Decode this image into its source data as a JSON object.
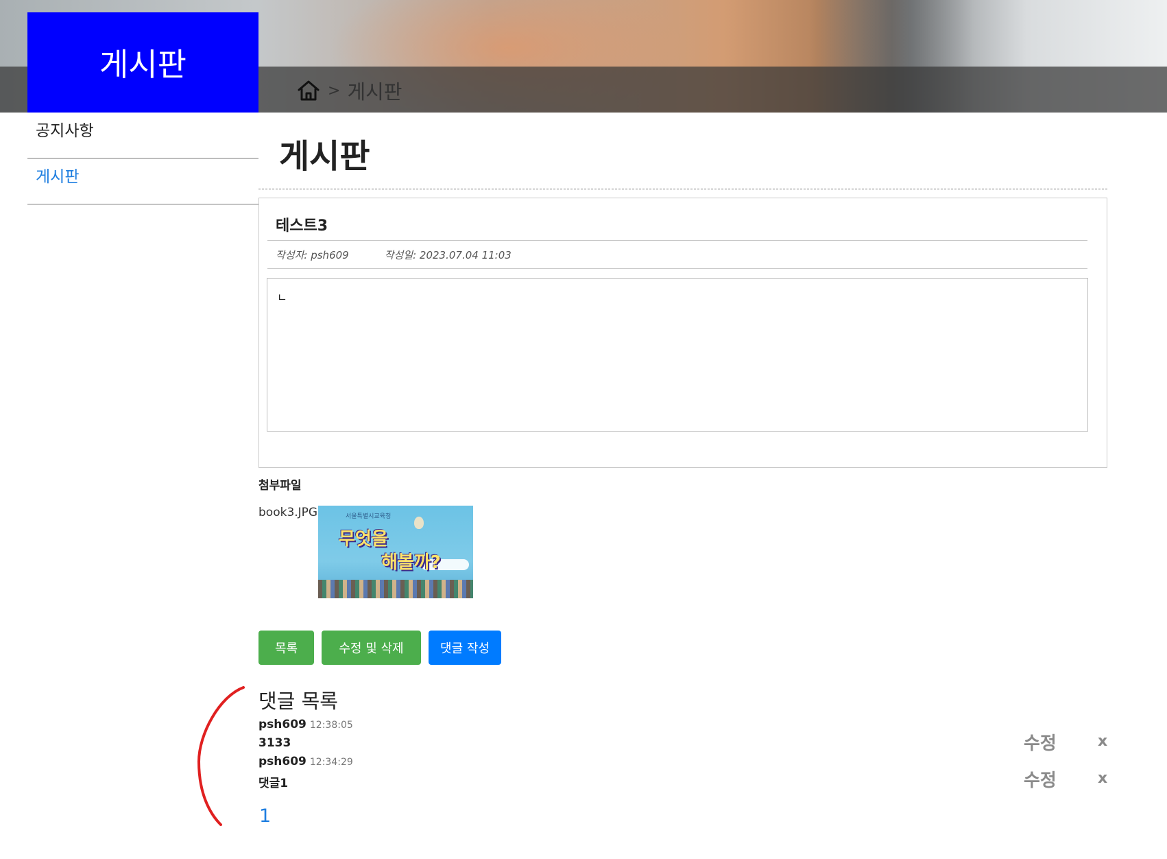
{
  "sidebar": {
    "title": "게시판",
    "items": [
      {
        "label": "공지사항",
        "active": false
      },
      {
        "label": "게시판",
        "active": true
      }
    ]
  },
  "breadcrumb": {
    "home_icon": "home-icon",
    "separator": ">",
    "current": "게시판"
  },
  "main": {
    "page_title": "게시판"
  },
  "post": {
    "title": "테스트3",
    "author": "작성자: psh609",
    "date": "작성일: 2023.07.04 11:03",
    "content": "ㄴ"
  },
  "attachment": {
    "label": "첨부파일",
    "file_name": "book3.JPG",
    "thumb_small": "서울특별시교육청",
    "thumb_line1": "무엇을",
    "thumb_line2": "해볼까?"
  },
  "buttons": {
    "list": "목록",
    "edit_delete": "수정 및 삭제",
    "write_comment": "댓글 작성"
  },
  "comments": {
    "title": "댓글 목록",
    "items": [
      {
        "user": "psh609",
        "time": "12:38:05",
        "text": "3133",
        "edit": "수정",
        "delete": "x"
      },
      {
        "user": "psh609",
        "time": "12:34:29",
        "text": "댓글1",
        "edit": "수정",
        "delete": "x"
      }
    ]
  },
  "pagination": {
    "current": "1"
  },
  "colors": {
    "sidebar_title_bg": "#0000ff",
    "active_link": "#1e7ee0",
    "button_green": "#4cae4c",
    "button_blue": "#007bff",
    "annotation_red": "#e02020"
  }
}
